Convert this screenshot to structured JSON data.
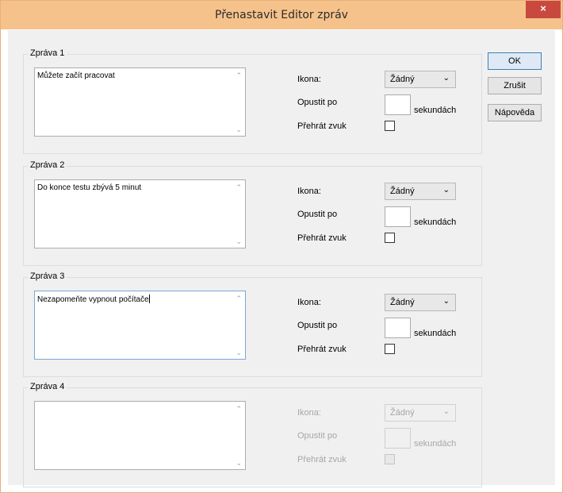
{
  "window": {
    "title": "Přenastavit Editor zpráv",
    "close_glyph": "×"
  },
  "labels": {
    "icon": "Ikona:",
    "leave_after": "Opustit po",
    "seconds": "sekundách",
    "play_sound": "Přehrát zvuk"
  },
  "messages": [
    {
      "legend": "Zpráva 1",
      "text": "Můžete začít pracovat",
      "icon": "Žádný",
      "seconds": "",
      "play_sound": false,
      "enabled": true,
      "focused": false
    },
    {
      "legend": "Zpráva 2",
      "text": "Do konce testu zbývá 5 minut",
      "icon": "Žádný",
      "seconds": "",
      "play_sound": false,
      "enabled": true,
      "focused": false
    },
    {
      "legend": "Zpráva 3",
      "text": "Nezapomeňte vypnout počítače",
      "icon": "Žádný",
      "seconds": "",
      "play_sound": false,
      "enabled": true,
      "focused": true
    },
    {
      "legend": "Zpráva 4",
      "text": "",
      "icon": "Žádný",
      "seconds": "",
      "play_sound": false,
      "enabled": false,
      "focused": false
    }
  ],
  "buttons": {
    "ok": "OK",
    "cancel": "Zrušit",
    "help": "Nápověda"
  },
  "glyphs": {
    "scroll_up": "⌃",
    "scroll_down": "⌄",
    "dropdown": "⌄"
  },
  "colors": {
    "title_bar": "#f6c28b",
    "close_button": "#c9493f",
    "focus_border": "#7aa7d9"
  }
}
